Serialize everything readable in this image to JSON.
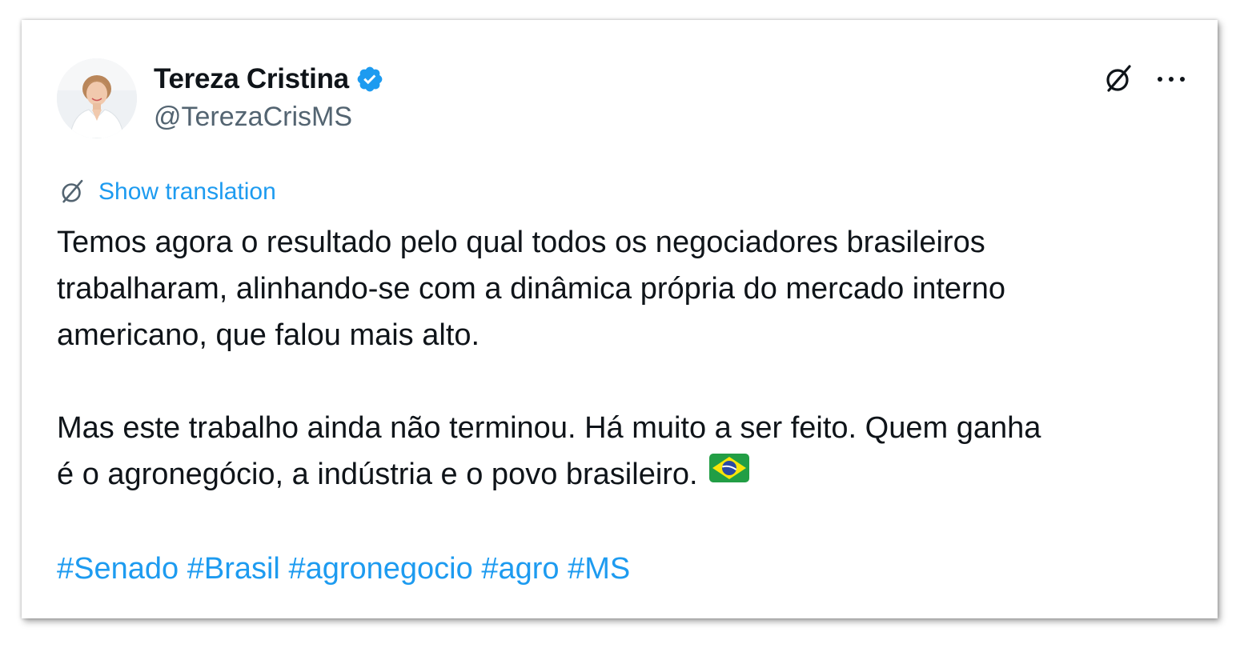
{
  "author": {
    "name": "Tereza Cristina",
    "handle": "@TerezaCrisMS"
  },
  "icons": {
    "verified": "verified-badge-icon",
    "grok": "grok-icon",
    "more": "more-options-icon",
    "translate": "grok-translate-icon",
    "flag": "brazil-flag-emoji"
  },
  "translation": {
    "label": "Show translation"
  },
  "tweet": {
    "lines": [
      "Temos agora o resultado pelo qual todos os negociadores brasileiros",
      "trabalharam, alinhando-se com a dinâmica própria do mercado interno",
      "americano, que falou mais alto.",
      "Mas este trabalho ainda não terminou. Há muito a ser feito. Quem ganha",
      "é o agronegócio, a indústria e o povo brasileiro."
    ],
    "hashtags": [
      "#Senado",
      "#Brasil",
      "#agronegocio",
      "#agro",
      "#MS"
    ]
  },
  "colors": {
    "link": "#1d9bf0",
    "text": "#0f1419",
    "secondary": "#536471",
    "verified": "#1d9bf0"
  }
}
